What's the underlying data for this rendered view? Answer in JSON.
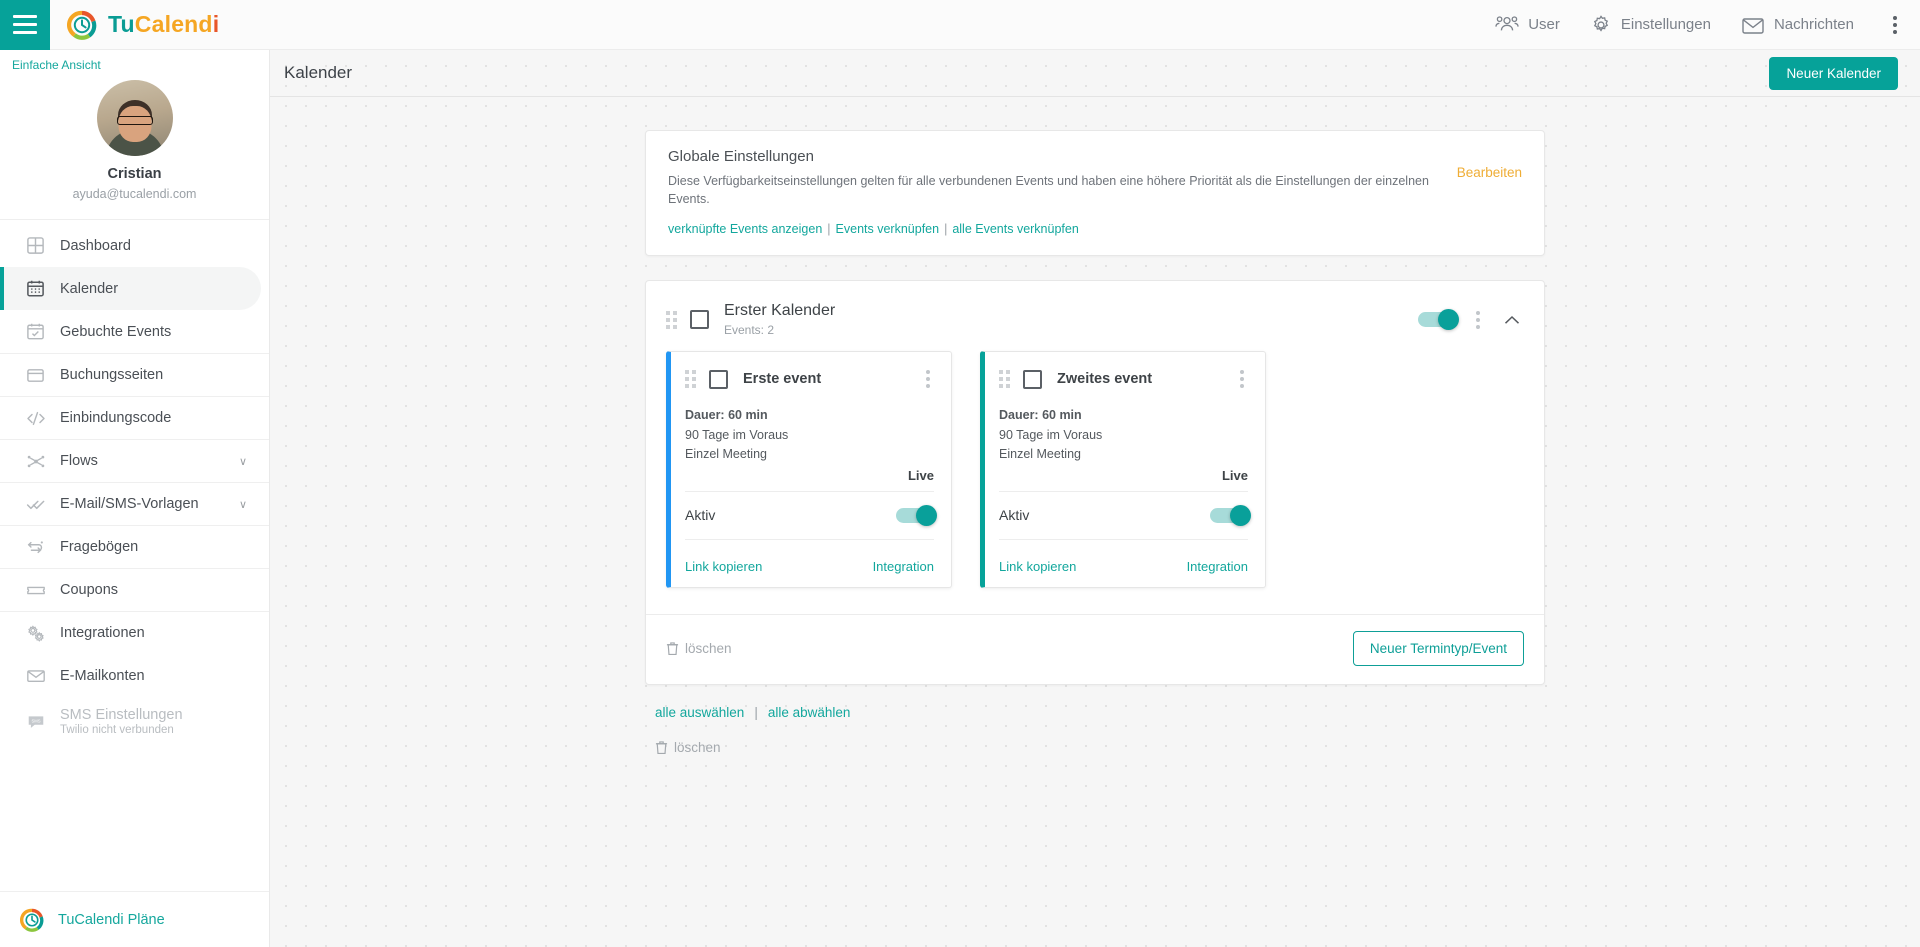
{
  "topbar": {
    "menu_icon": "hamburger-icon",
    "brand": {
      "part1": "Tu",
      "part2": "Calend",
      "part3": "i"
    },
    "items": [
      {
        "label": "User",
        "icon": "users-icon"
      },
      {
        "label": "Einstellungen",
        "icon": "gear-icon"
      },
      {
        "label": "Nachrichten",
        "icon": "envelope-icon"
      }
    ],
    "overflow_icon": "kebab-vertical-icon"
  },
  "sidebar": {
    "simple_view": "Einfache Ansicht",
    "profile": {
      "name": "Cristian",
      "email": "ayuda@tucalendi.com",
      "avatar": "user-avatar"
    },
    "items": [
      {
        "label": "Dashboard",
        "icon": "dashboard-grid-icon",
        "active": false
      },
      {
        "label": "Kalender",
        "icon": "calendar-icon",
        "active": true
      },
      {
        "label": "Gebuchte Events",
        "icon": "calendar-check-icon",
        "active": false
      },
      {
        "label": "Buchungsseiten",
        "icon": "window-icon",
        "active": false
      },
      {
        "label": "Einbindungscode",
        "icon": "code-icon",
        "active": false
      },
      {
        "label": "Flows",
        "icon": "flows-icon",
        "active": false,
        "chevron": "∨"
      },
      {
        "label": "E-Mail/SMS-Vorlagen",
        "icon": "double-check-icon",
        "active": false,
        "chevron": "∨"
      },
      {
        "label": "Fragebögen",
        "icon": "survey-icon",
        "active": false
      },
      {
        "label": "Coupons",
        "icon": "ticket-icon",
        "active": false
      },
      {
        "label": "Integrationen",
        "icon": "gears-icon",
        "active": false
      },
      {
        "label": "E-Mailkonten",
        "icon": "mail-icon",
        "active": false
      },
      {
        "label": "SMS Einstellungen",
        "sub": "Twilio nicht verbunden",
        "icon": "sms-bubble-icon",
        "active": false,
        "disabled": true
      }
    ],
    "plans": "TuCalendi Pläne"
  },
  "page": {
    "title": "Kalender",
    "new_calendar_button": "Neuer Kalender"
  },
  "global_settings": {
    "title": "Globale Einstellungen",
    "description": "Diese Verfügbarkeitseinstellungen gelten für alle verbundenen Events und haben eine höhere Priorität als die Einstellungen der einzelnen Events.",
    "links": [
      "verknüpfte Events anzeigen",
      "Events verknüpfen",
      "alle Events verknüpfen"
    ],
    "link_divider": "|",
    "edit_label": "Bearbeiten"
  },
  "calendar": {
    "name": "Erster Kalender",
    "events_count_label": "Events: 2",
    "enabled": true,
    "collapse_icon": "chevron-up-icon",
    "menu_icon": "kebab-vertical-icon",
    "events": [
      {
        "title": "Erste event",
        "duration": "Dauer: 60 min",
        "advance": "90 Tage im Voraus",
        "type": "Einzel Meeting",
        "status": "Live",
        "active_label": "Aktiv",
        "active": true,
        "copy_link": "Link kopieren",
        "integration": "Integration",
        "accent": "#2196f3"
      },
      {
        "title": "Zweites event",
        "duration": "Dauer: 60 min",
        "advance": "90 Tage im Voraus",
        "type": "Einzel Meeting",
        "status": "Live",
        "active_label": "Aktiv",
        "active": true,
        "copy_link": "Link kopieren",
        "integration": "Integration",
        "accent": "#06a299"
      }
    ],
    "delete_label": "löschen",
    "new_event_button": "Neuer Termintyp/Event"
  },
  "bottom_tools": {
    "select_all": "alle auswählen",
    "deselect_all": "alle abwählen",
    "divider": "|",
    "delete_label": "löschen"
  },
  "colors": {
    "accent_teal": "#06a299",
    "link_teal": "#13a79d",
    "edit_orange": "#efad35",
    "event_blue": "#2196f3"
  }
}
